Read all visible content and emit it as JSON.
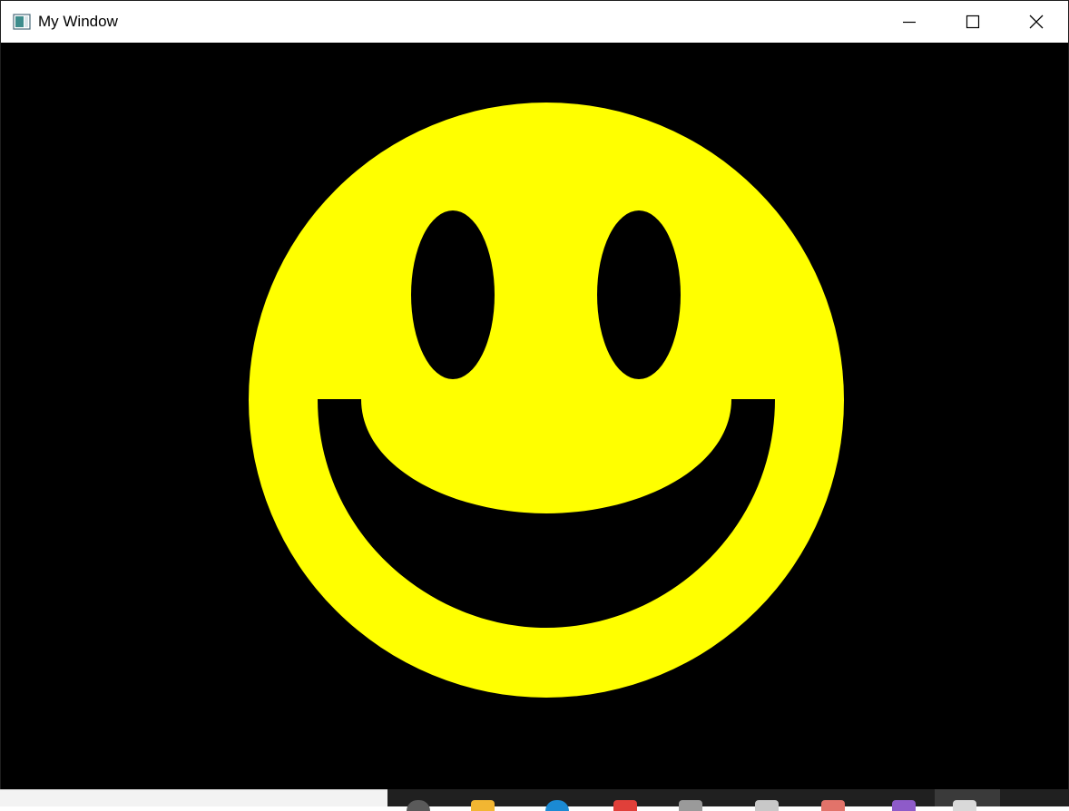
{
  "window": {
    "title": "My Window",
    "controls": {
      "minimize": "minimize-icon",
      "maximize": "maximize-icon",
      "close": "close-icon"
    }
  },
  "canvas": {
    "background": "#000000",
    "face_color": "#ffff00",
    "feature_color": "#000000"
  },
  "taskbar": {
    "background": "#202020",
    "search_area_color": "#f3f3f3",
    "icons": [
      {
        "name": "cortana-icon",
        "color": "#5a5a5a"
      },
      {
        "name": "file-explorer-icon",
        "color": "#f2b632"
      },
      {
        "name": "edge-icon",
        "color": "#1b8ad3"
      },
      {
        "name": "app-red-icon",
        "color": "#e0403a"
      },
      {
        "name": "app-gray-icon",
        "color": "#9a9a9a"
      },
      {
        "name": "notepad-icon",
        "color": "#c8c8c8"
      },
      {
        "name": "paint-icon",
        "color": "#e2736a"
      },
      {
        "name": "visual-studio-icon",
        "color": "#8e5bc9"
      },
      {
        "name": "my-window-task-icon",
        "color": "#d9d9d9"
      }
    ]
  }
}
